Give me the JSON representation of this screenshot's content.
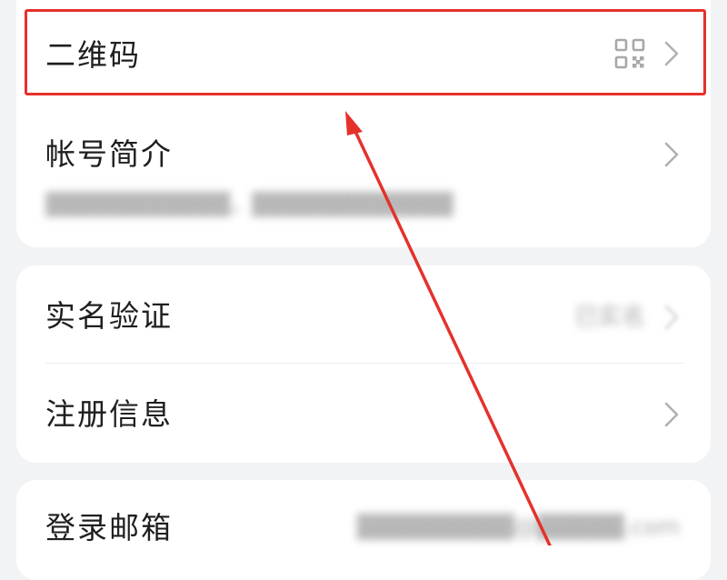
{
  "profile_card": {
    "qr_code": {
      "label": "二维码",
      "icon": "qr-code-icon"
    },
    "account_intro": {
      "label": "帐号简介",
      "value": "▓▓▓▓▓▓▓▓▓▓▓，▓▓▓▓▓▓▓▓▓▓▓▓"
    }
  },
  "verification_card": {
    "real_name": {
      "label": "实名验证",
      "status": "已实名"
    },
    "registration": {
      "label": "注册信息"
    }
  },
  "login_card": {
    "email": {
      "label": "登录邮箱",
      "value": "▓▓▓▓▓▓▓▓▓@▓▓▓▓▓.com"
    }
  },
  "annotation": {
    "highlight_color": "#e5312b"
  }
}
